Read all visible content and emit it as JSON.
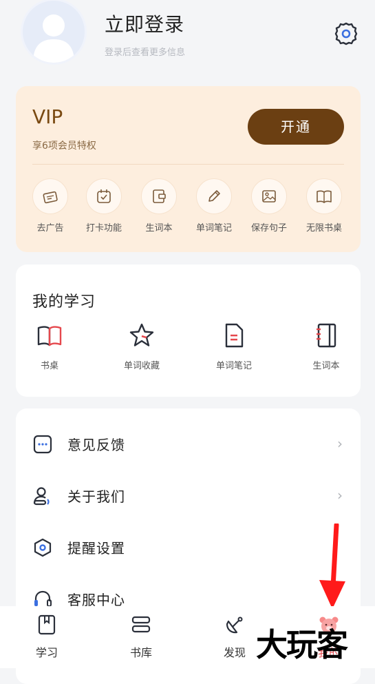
{
  "header": {
    "login_title": "立即登录",
    "login_subtitle": "登录后查看更多信息"
  },
  "vip": {
    "title": "VIP",
    "subtitle": "享6项会员特权",
    "button": "开通",
    "perks": [
      {
        "label": "去广告",
        "icon": "ad-remove-icon"
      },
      {
        "label": "打卡功能",
        "icon": "calendar-check-icon"
      },
      {
        "label": "生词本",
        "icon": "wallet-book-icon"
      },
      {
        "label": "单词笔记",
        "icon": "pencil-icon"
      },
      {
        "label": "保存句子",
        "icon": "image-icon"
      },
      {
        "label": "无限书桌",
        "icon": "open-book-icon"
      }
    ]
  },
  "study": {
    "title": "我的学习",
    "items": [
      {
        "label": "书桌",
        "icon": "open-book-icon"
      },
      {
        "label": "单词收藏",
        "icon": "star-icon"
      },
      {
        "label": "单词笔记",
        "icon": "note-icon"
      },
      {
        "label": "生词本",
        "icon": "notebook-icon"
      }
    ]
  },
  "menu": {
    "items": [
      {
        "label": "意见反馈",
        "icon": "chat-dots-icon"
      },
      {
        "label": "关于我们",
        "icon": "user-icon"
      },
      {
        "label": "提醒设置",
        "icon": "hexagon-icon"
      },
      {
        "label": "客服中心",
        "icon": "headset-icon"
      }
    ]
  },
  "nav": {
    "items": [
      {
        "label": "学习",
        "icon": "bookmark-icon"
      },
      {
        "label": "书库",
        "icon": "stack-icon"
      },
      {
        "label": "发现",
        "icon": "satellite-icon"
      },
      {
        "label": "我的",
        "icon": "bear-icon",
        "active": true
      }
    ]
  },
  "watermark": "大玩客",
  "colors": {
    "accent": "#e5484d",
    "vip_brown": "#6b3f12",
    "vip_bg": "#fdeede",
    "annotation_arrow": "#ff1a1a"
  }
}
